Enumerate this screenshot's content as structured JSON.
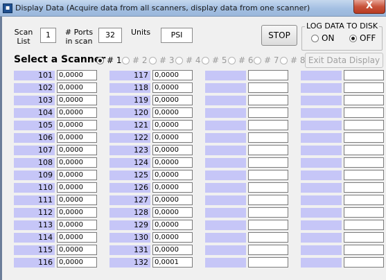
{
  "window": {
    "title": "Display Data  (Acquire data from all scanners, display data from  one scanner)",
    "close_label": "X"
  },
  "header": {
    "scan_list_label_line1": "Scan",
    "scan_list_label_line2": "List",
    "scan_list_value": "1",
    "ports_label_line1": "# Ports",
    "ports_label_line2": "in scan",
    "ports_value": "32",
    "units_label": "Units",
    "units_value": "PSI",
    "stop_label": "STOP",
    "log_title": "LOG DATA TO DISK",
    "log_on_label": "ON",
    "log_off_label": "OFF",
    "log_selected": "OFF"
  },
  "scanner_select": {
    "label": "Select a Scanner",
    "options": [
      "# 1",
      "# 2",
      "# 3",
      "# 4",
      "# 5",
      "# 6",
      "# 7",
      "# 8"
    ],
    "selected_index": 0,
    "exit_label": "Exit Data Display"
  },
  "columns": [
    {
      "rows": [
        {
          "port": "101",
          "value": "0,0000"
        },
        {
          "port": "102",
          "value": "0,0000"
        },
        {
          "port": "103",
          "value": "0,0000"
        },
        {
          "port": "104",
          "value": "0,0000"
        },
        {
          "port": "105",
          "value": "0,0000"
        },
        {
          "port": "106",
          "value": "0,0000"
        },
        {
          "port": "107",
          "value": "0,0000"
        },
        {
          "port": "108",
          "value": "0,0000"
        },
        {
          "port": "109",
          "value": "0,0000"
        },
        {
          "port": "110",
          "value": "0,0000"
        },
        {
          "port": "111",
          "value": "0,0000"
        },
        {
          "port": "112",
          "value": "0,0000"
        },
        {
          "port": "113",
          "value": "0,0000"
        },
        {
          "port": "114",
          "value": "0,0000"
        },
        {
          "port": "115",
          "value": "0,0000"
        },
        {
          "port": "116",
          "value": "0,0000"
        }
      ]
    },
    {
      "rows": [
        {
          "port": "117",
          "value": "0,0000"
        },
        {
          "port": "118",
          "value": "0,0000"
        },
        {
          "port": "119",
          "value": "0,0000"
        },
        {
          "port": "120",
          "value": "0,0000"
        },
        {
          "port": "121",
          "value": "0,0000"
        },
        {
          "port": "122",
          "value": "0,0000"
        },
        {
          "port": "123",
          "value": "0,0000"
        },
        {
          "port": "124",
          "value": "0,0000"
        },
        {
          "port": "125",
          "value": "0,0000"
        },
        {
          "port": "126",
          "value": "0,0000"
        },
        {
          "port": "127",
          "value": "0,0000"
        },
        {
          "port": "128",
          "value": "0,0000"
        },
        {
          "port": "129",
          "value": "0,0000"
        },
        {
          "port": "130",
          "value": "0,0000"
        },
        {
          "port": "131",
          "value": "0,0000"
        },
        {
          "port": "132",
          "value": "0,0001"
        }
      ]
    },
    {
      "rows": [
        {
          "port": "",
          "value": ""
        },
        {
          "port": "",
          "value": ""
        },
        {
          "port": "",
          "value": ""
        },
        {
          "port": "",
          "value": ""
        },
        {
          "port": "",
          "value": ""
        },
        {
          "port": "",
          "value": ""
        },
        {
          "port": "",
          "value": ""
        },
        {
          "port": "",
          "value": ""
        },
        {
          "port": "",
          "value": ""
        },
        {
          "port": "",
          "value": ""
        },
        {
          "port": "",
          "value": ""
        },
        {
          "port": "",
          "value": ""
        },
        {
          "port": "",
          "value": ""
        },
        {
          "port": "",
          "value": ""
        },
        {
          "port": "",
          "value": ""
        },
        {
          "port": "",
          "value": ""
        }
      ]
    },
    {
      "rows": [
        {
          "port": "",
          "value": ""
        },
        {
          "port": "",
          "value": ""
        },
        {
          "port": "",
          "value": ""
        },
        {
          "port": "",
          "value": ""
        },
        {
          "port": "",
          "value": ""
        },
        {
          "port": "",
          "value": ""
        },
        {
          "port": "",
          "value": ""
        },
        {
          "port": "",
          "value": ""
        },
        {
          "port": "",
          "value": ""
        },
        {
          "port": "",
          "value": ""
        },
        {
          "port": "",
          "value": ""
        },
        {
          "port": "",
          "value": ""
        },
        {
          "port": "",
          "value": ""
        },
        {
          "port": "",
          "value": ""
        },
        {
          "port": "",
          "value": ""
        },
        {
          "port": "",
          "value": ""
        }
      ]
    }
  ],
  "colors": {
    "port_cell_bg": "#c6c6f7",
    "titlebar": "#a3bfe2",
    "close_button": "#c8533b"
  }
}
